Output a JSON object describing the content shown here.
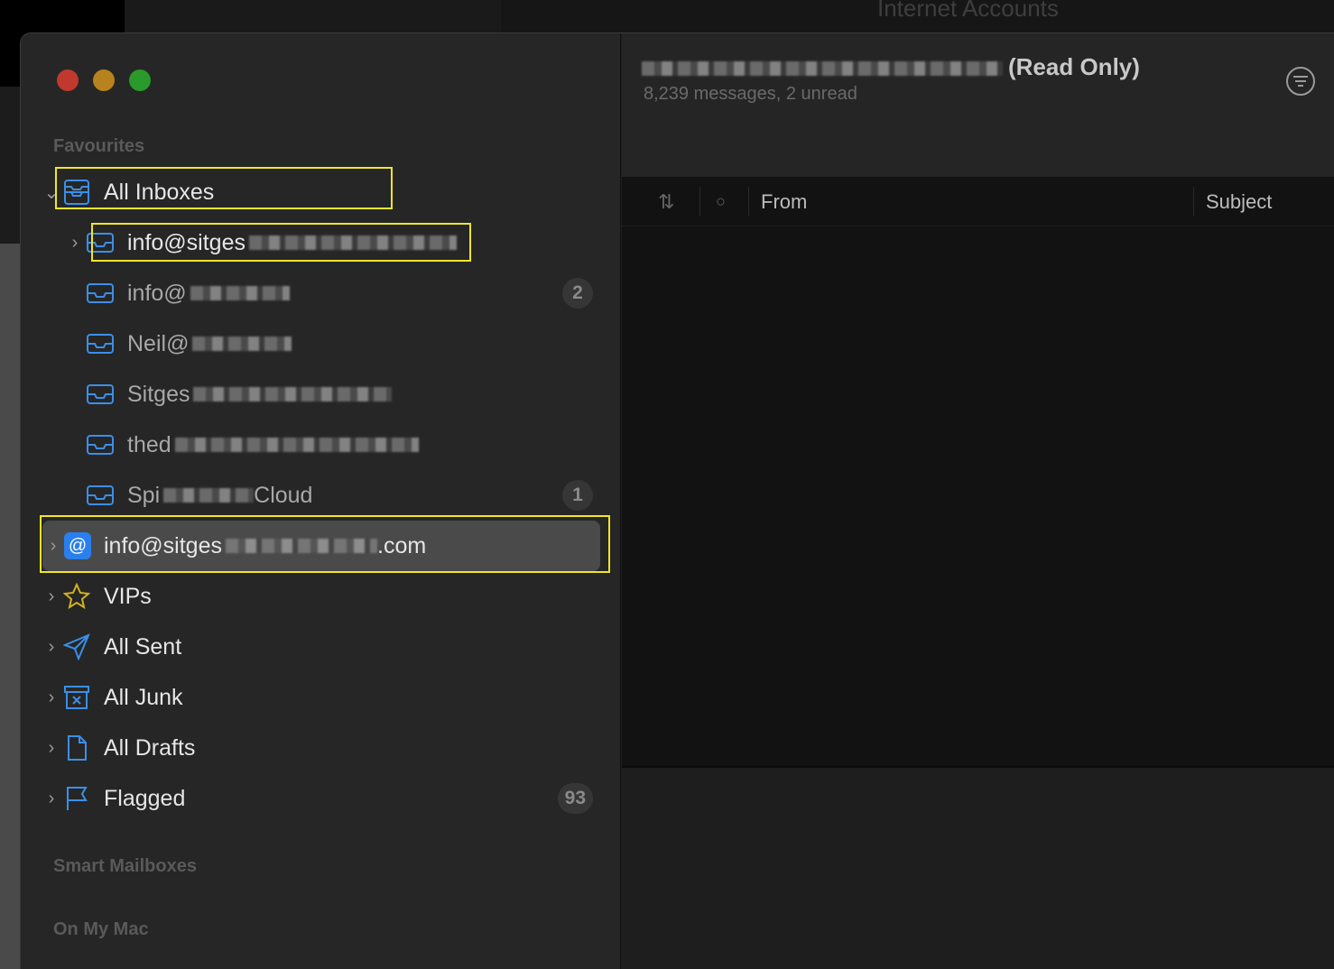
{
  "background_window": {
    "title": "Internet Accounts"
  },
  "sidebar": {
    "favourites_label": "Favourites",
    "all_inboxes": "All Inboxes",
    "inboxes": [
      {
        "label": "info@sitges",
        "badge": ""
      },
      {
        "label": "info@",
        "badge": "2"
      },
      {
        "label": "Neil@",
        "badge": ""
      },
      {
        "label": "Sitges",
        "badge": ""
      },
      {
        "label": "thed",
        "badge": ""
      },
      {
        "label": "Spi",
        "label_end": "Cloud",
        "badge": "1"
      }
    ],
    "account": {
      "label": "info@sitges",
      "label_end": ".com"
    },
    "items": [
      {
        "label": "VIPs",
        "icon": "star-icon"
      },
      {
        "label": "All Sent",
        "icon": "paper-plane-icon"
      },
      {
        "label": "All Junk",
        "icon": "junk-box-icon"
      },
      {
        "label": "All Drafts",
        "icon": "document-icon"
      },
      {
        "label": "Flagged",
        "icon": "flag-icon",
        "badge": "93"
      }
    ],
    "smart_mailboxes_label": "Smart Mailboxes",
    "on_my_mac_label": "On My Mac"
  },
  "main": {
    "title_suffix": "(Read Only)",
    "subtitle": "8,239 messages, 2 unread",
    "columns": [
      "From",
      "Subject"
    ]
  },
  "colors": {
    "accent": "#3b8fe8",
    "highlight_box": "#f2e626",
    "selected_row": "#4a4a4a"
  }
}
